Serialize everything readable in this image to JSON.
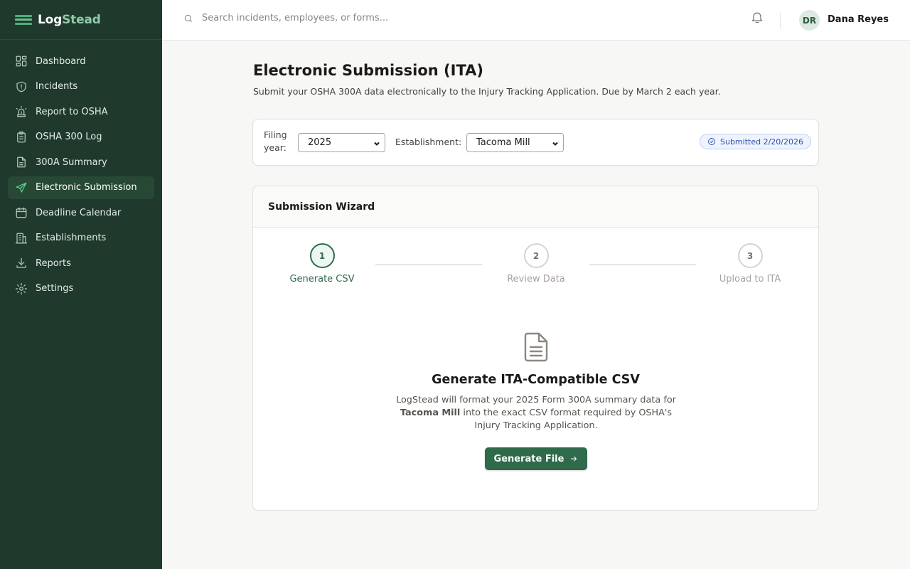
{
  "brand": {
    "name_part1": "Log",
    "name_part2": "Stead"
  },
  "sidebar": {
    "items": [
      {
        "label": "Dashboard",
        "icon": "dashboard-icon",
        "active": false
      },
      {
        "label": "Incidents",
        "icon": "shield-alert-icon",
        "active": false
      },
      {
        "label": "Report to OSHA",
        "icon": "siren-icon",
        "active": false
      },
      {
        "label": "OSHA 300 Log",
        "icon": "clipboard-icon",
        "active": false
      },
      {
        "label": "300A Summary",
        "icon": "file-text-icon",
        "active": false
      },
      {
        "label": "Electronic Submission",
        "icon": "send-icon",
        "active": true
      },
      {
        "label": "Deadline Calendar",
        "icon": "calendar-icon",
        "active": false
      },
      {
        "label": "Establishments",
        "icon": "building-icon",
        "active": false
      },
      {
        "label": "Reports",
        "icon": "download-icon",
        "active": false
      },
      {
        "label": "Settings",
        "icon": "gear-icon",
        "active": false
      }
    ]
  },
  "topbar": {
    "search_placeholder": "Search incidents, employees, or forms...",
    "user_initials": "DR",
    "user_name": "Dana Reyes"
  },
  "page": {
    "title": "Electronic Submission (ITA)",
    "subtitle": "Submit your OSHA 300A data electronically to the Injury Tracking Application. Due by March 2 each year."
  },
  "filters": {
    "year_label": "Filing year:",
    "year_value": "2025",
    "establishment_label": "Establishment:",
    "establishment_value": "Tacoma Mill",
    "status_badge": "Submitted 2/20/2026"
  },
  "wizard": {
    "title": "Submission Wizard",
    "steps": [
      {
        "number": "1",
        "label": "Generate CSV",
        "active": true
      },
      {
        "number": "2",
        "label": "Review Data",
        "active": false
      },
      {
        "number": "3",
        "label": "Upload to ITA",
        "active": false
      }
    ],
    "panel": {
      "heading": "Generate ITA-Compatible CSV",
      "desc_part1": "LogStead will format your 2025 Form 300A summary data for",
      "desc_bold": "Tacoma Mill",
      "desc_part2": "into the exact CSV format required by OSHA's Injury Tracking Application.",
      "button_label": "Generate File"
    }
  },
  "colors": {
    "sidebar_bg": "#1f3a2d",
    "accent": "#2f6a4b",
    "active_icon": "#5ed394",
    "badge_blue": "#2c4fa8"
  }
}
